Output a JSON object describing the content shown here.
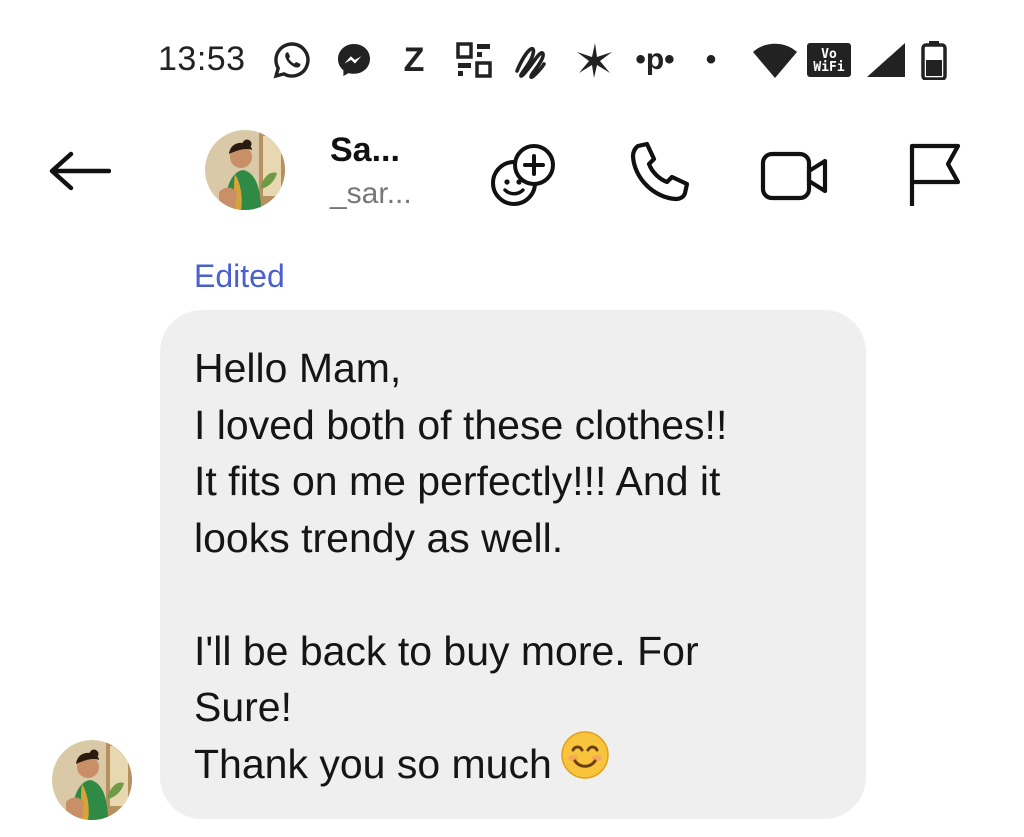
{
  "status_bar": {
    "time": "13:53",
    "notification_icons": [
      "whatsapp-icon",
      "messenger-icon",
      "z-app-icon",
      "qr-app-icon",
      "swirl-app-icon",
      "spark-app-icon",
      "paytm-icon",
      "dot-icon"
    ],
    "z_glyph": "Z",
    "paytm_glyph": "•p•",
    "dot_glyph": "•",
    "vowifi_top": "Vo",
    "vowifi_bottom": "WiFi",
    "system_icons": [
      "wifi-icon",
      "vowifi-icon",
      "signal-icon",
      "battery-icon"
    ]
  },
  "header": {
    "back_icon": "arrow-left-icon",
    "contact_name": "Sa...",
    "contact_handle": "_sar...",
    "actions": [
      "add-emoji-icon",
      "phone-icon",
      "video-icon",
      "flag-icon"
    ]
  },
  "conversation": {
    "edited_label": "Edited",
    "message_lines": [
      "Hello Mam,",
      "I loved both of these clothes!!",
      "It fits on me perfectly!!! And it",
      "looks trendy as well.",
      "",
      "I'll be back to buy more. For",
      "Sure!",
      "Thank you so much"
    ],
    "trailing_emoji": "smiling-face-emoji"
  },
  "colors": {
    "bubble_bg": "#efefef",
    "edited_text": "#4a5fd0",
    "icon_stroke": "#111111",
    "emoji_yellow": "#f7c43b"
  }
}
